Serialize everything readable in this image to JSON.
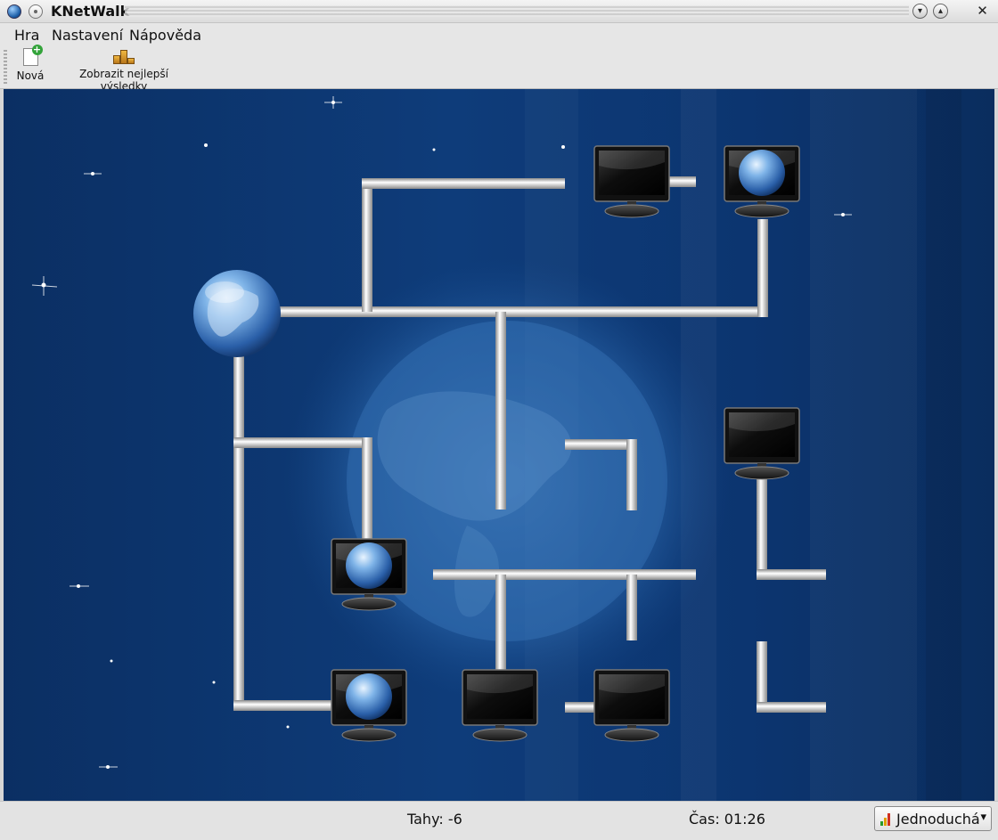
{
  "window": {
    "title": "KNetWalk",
    "min_icon": "chevron-down-icon",
    "max_icon": "chevron-up-icon",
    "close_glyph": "✕"
  },
  "menu": {
    "items": [
      {
        "label": "Hra"
      },
      {
        "label": "Nastavení"
      },
      {
        "label": "Nápověda"
      }
    ]
  },
  "toolbar": {
    "new_label": "Nová",
    "highscores_label": "Zobrazit nejlepší výsledky"
  },
  "board": {
    "grid_rows": 5,
    "grid_cols": 5,
    "server_icon": "globe-icon",
    "terminal_icon": "monitor-icon",
    "connected_terminal_icon": "monitor-globe-icon"
  },
  "status": {
    "moves": "Tahy: -6",
    "time": "Čas: 01:26",
    "difficulty": "Jednoduchá",
    "accent_colors": [
      "#2a9a2a",
      "#e0a000",
      "#d03020"
    ]
  }
}
